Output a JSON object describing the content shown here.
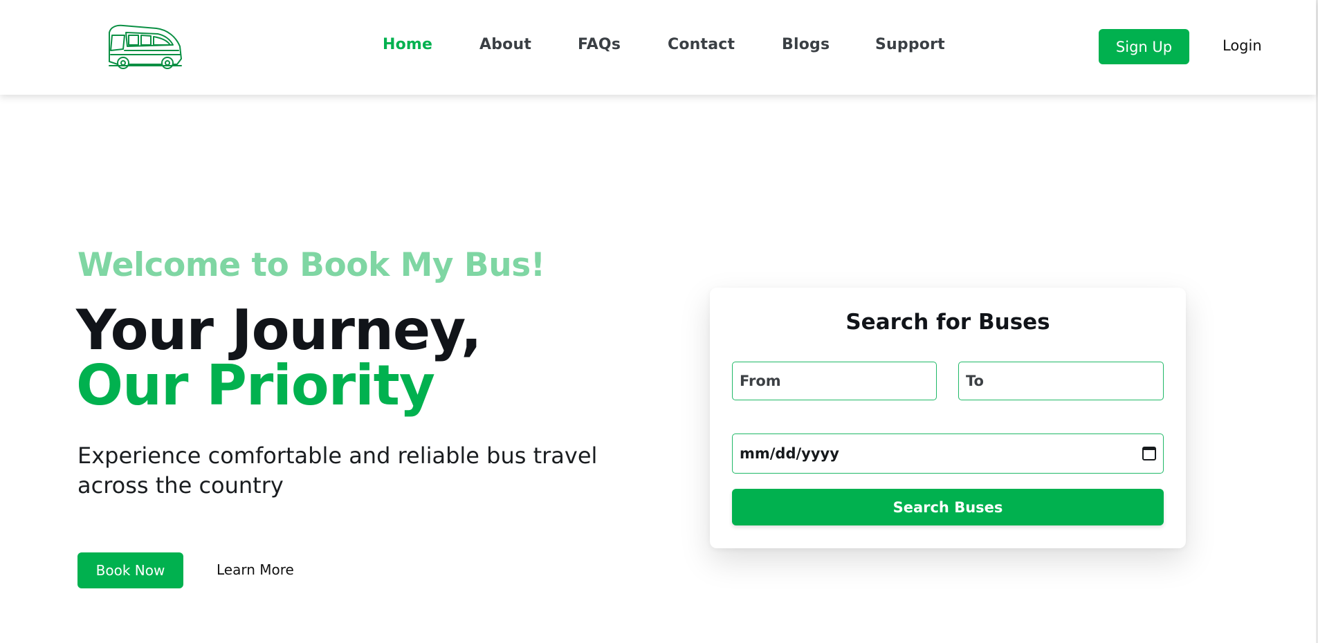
{
  "brand": {
    "logo_icon": "bus-icon",
    "accent_color": "#01b14f",
    "accent_light_color": "#7fd6a3"
  },
  "nav": {
    "items": [
      {
        "label": "Home",
        "active": true
      },
      {
        "label": "About",
        "active": false
      },
      {
        "label": "FAQs",
        "active": false
      },
      {
        "label": "Contact",
        "active": false
      },
      {
        "label": "Blogs",
        "active": false
      },
      {
        "label": "Support",
        "active": false
      }
    ],
    "signup_label": "Sign Up",
    "login_label": "Login"
  },
  "hero": {
    "welcome": "Welcome to Book My Bus!",
    "headline_line1": "Your Journey,",
    "headline_line2": "Our Priority",
    "subtext": "Experience comfortable and reliable bus travel across the country",
    "book_label": "Book Now",
    "learn_label": "Learn More"
  },
  "search": {
    "title": "Search for Buses",
    "from_placeholder": "From",
    "to_placeholder": "To",
    "date_placeholder": "mm/dd/yyyy",
    "date_icon": "calendar-icon",
    "button_label": "Search Buses"
  }
}
